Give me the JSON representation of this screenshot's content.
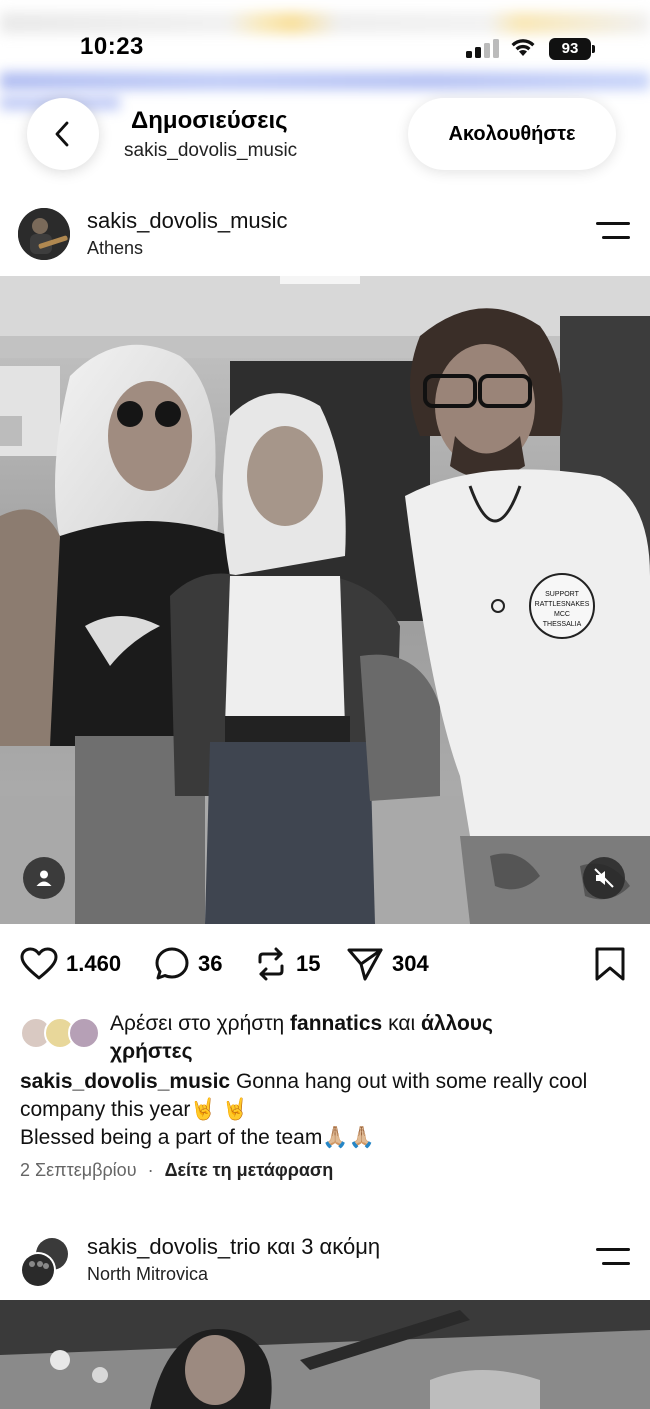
{
  "status": {
    "time": "10:23",
    "battery": "93"
  },
  "nav": {
    "title": "Δημοσιεύσεις",
    "subtitle": "sakis_dovolis_music",
    "follow_label": "Ακολουθήστε"
  },
  "post": {
    "username": "sakis_dovolis_music",
    "location": "Athens",
    "actions": {
      "likes": "1.460",
      "comments": "36",
      "reposts": "15",
      "shares": "304"
    },
    "liked_by_prefix": "Αρέσει στο χρήστη ",
    "liked_by_user": "fannatics",
    "liked_by_mid": " και ",
    "liked_by_others": "άλλους χρήστες",
    "caption_user": "sakis_dovolis_music",
    "caption_line1": " Gonna hang out with some really cool company this year🤘 🤘",
    "caption_line2": "Blessed being a part of the team🙏🏼🙏🏼",
    "date": "2 Σεπτεμβρίου",
    "separator": "·",
    "translate": "Δείτε τη μετάφραση",
    "shirt_text": "SUPPORT RATTLESNAKES MCC THESSALIA"
  },
  "next_post": {
    "username": "sakis_dovolis_trio",
    "suffix": " και 3 ακόμη",
    "location": "North Mitrovica"
  },
  "icons": {
    "back": "chevron-left-icon",
    "menu": "menu-icon",
    "like": "heart-icon",
    "comment": "comment-icon",
    "repost": "repost-icon",
    "share": "send-icon",
    "save": "bookmark-icon",
    "tags": "person-icon",
    "mute": "muted-speaker-icon"
  }
}
